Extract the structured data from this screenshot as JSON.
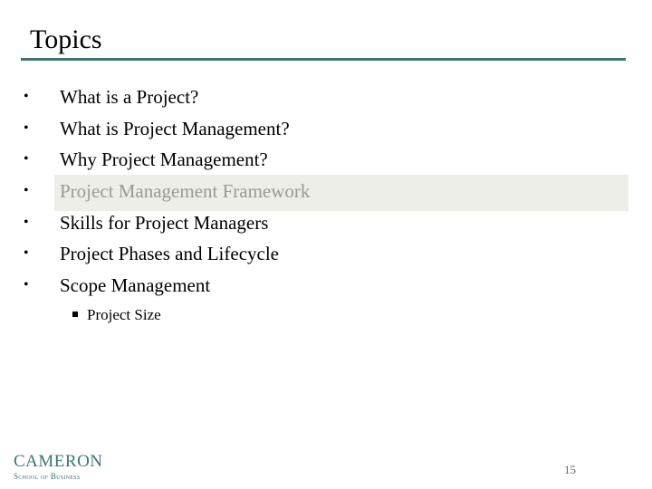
{
  "slide": {
    "title": "Topics",
    "items": [
      {
        "label": "What is a Project?",
        "dimmed": false
      },
      {
        "label": "What is Project Management?",
        "dimmed": false
      },
      {
        "label": "Why Project Management?",
        "dimmed": false
      },
      {
        "label": "Project Management Framework",
        "dimmed": true
      },
      {
        "label": "Skills for Project Managers",
        "dimmed": false
      },
      {
        "label": "Project Phases and Lifecycle",
        "dimmed": false
      },
      {
        "label": "Scope Management",
        "dimmed": false
      }
    ],
    "bullet": "•",
    "subitem": "Project Size",
    "page_number": "15"
  },
  "logo": {
    "line1": "CAMERON",
    "line2": "School of Business"
  },
  "colors": {
    "accent": "#3d7472",
    "highlight": "#eeeee8",
    "dimmed_text": "#9a9a92"
  }
}
